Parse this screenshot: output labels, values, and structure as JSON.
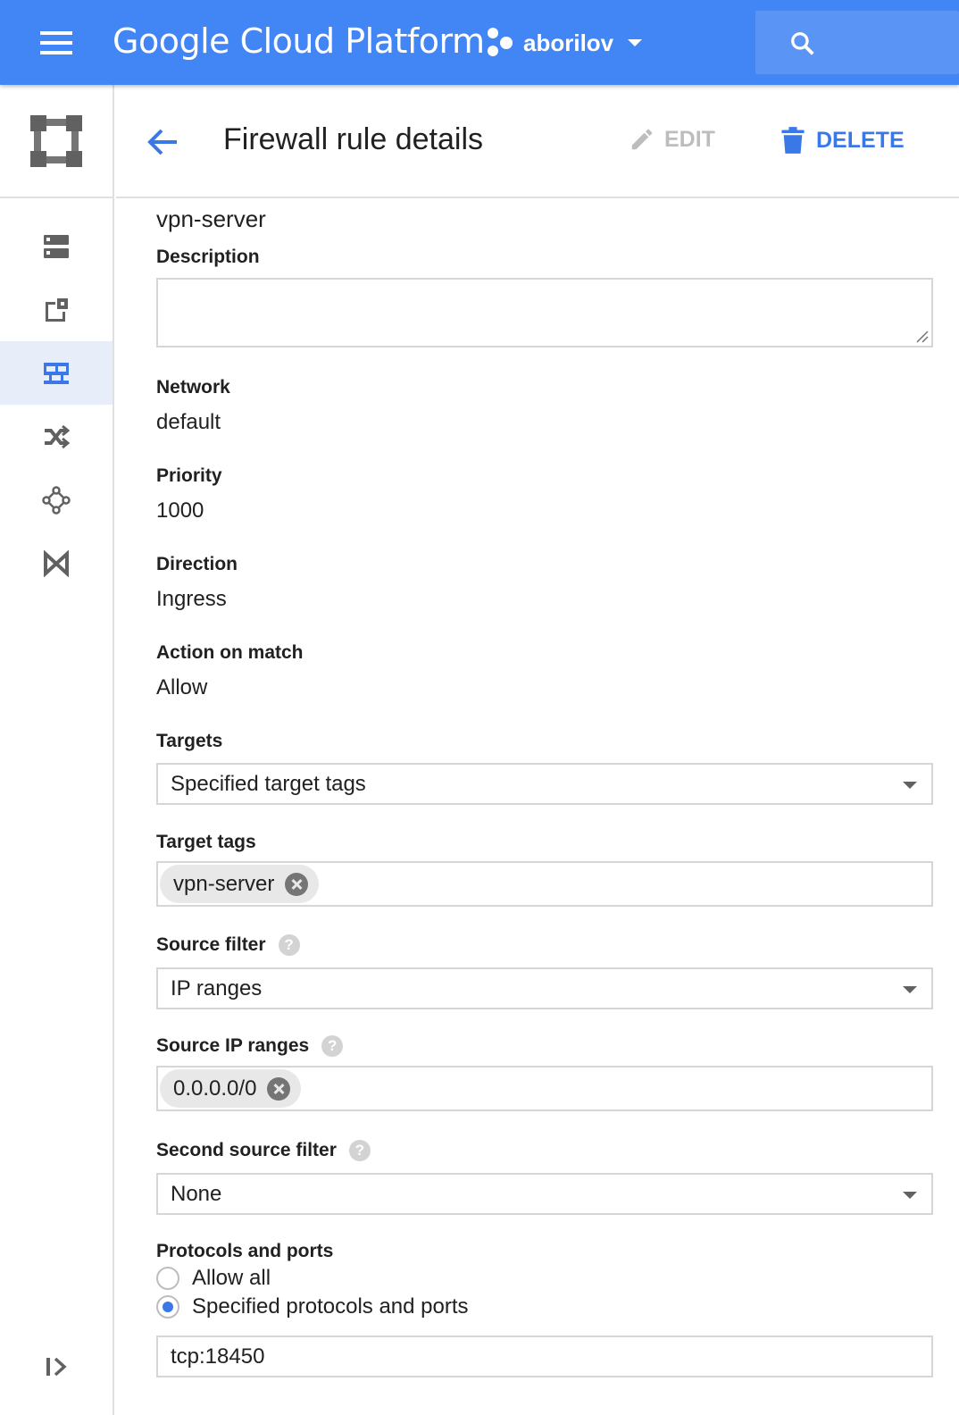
{
  "topbar": {
    "brand": "Google Cloud Platform",
    "project_name": "aborilov",
    "menu_icon": "hamburger-menu-icon",
    "search_icon": "search-icon",
    "color": "#4285f4"
  },
  "rail": {
    "logo_icon": "vpc-network-icon",
    "items": [
      {
        "icon": "vpc-networks-icon"
      },
      {
        "icon": "external-ip-icon"
      },
      {
        "icon": "firewall-icon",
        "active": true
      },
      {
        "icon": "routes-icon"
      },
      {
        "icon": "vpc-peering-icon"
      },
      {
        "icon": "shared-vpc-icon"
      }
    ],
    "expand_icon": "expand-rail-icon"
  },
  "header": {
    "title": "Firewall rule details",
    "edit_label": "EDIT",
    "delete_label": "DELETE",
    "accent": "#3b78e7"
  },
  "rule": {
    "name": "vpn-server",
    "description_label": "Description",
    "description_value": "",
    "network_label": "Network",
    "network_value": "default",
    "priority_label": "Priority",
    "priority_value": "1000",
    "direction_label": "Direction",
    "direction_value": "Ingress",
    "action_label": "Action on match",
    "action_value": "Allow",
    "targets_label": "Targets",
    "targets_value": "Specified target tags",
    "target_tags_label": "Target tags",
    "target_tags": [
      "vpn-server"
    ],
    "source_filter_label": "Source filter",
    "source_filter_value": "IP ranges",
    "source_ip_label": "Source IP ranges",
    "source_ip_ranges": [
      "0.0.0.0/0"
    ],
    "second_source_label": "Second source filter",
    "second_source_value": "None",
    "protocols_label": "Protocols and ports",
    "protocol_options": [
      "Allow all",
      "Specified protocols and ports"
    ],
    "protocol_selected": "Specified protocols and ports",
    "ports_value": "tcp:18450",
    "help_glyph": "?"
  }
}
